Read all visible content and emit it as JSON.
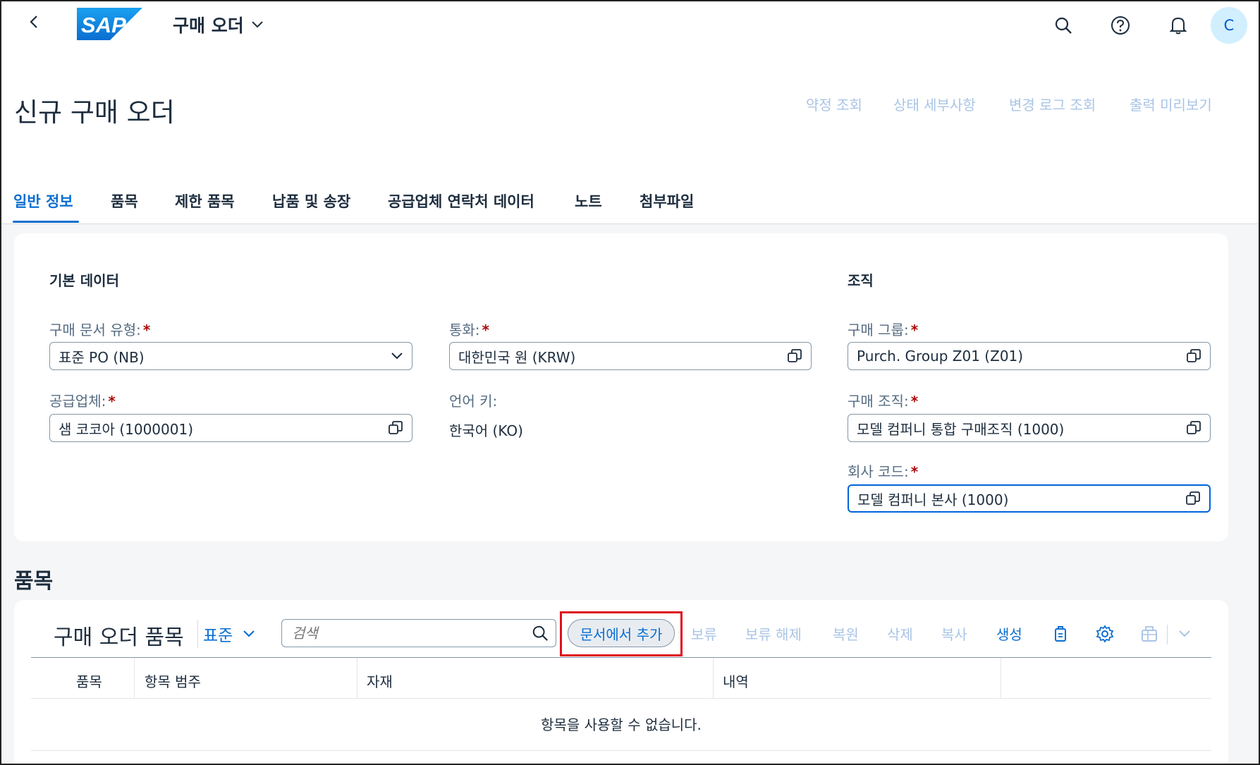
{
  "shell": {
    "logo_text": "SAP",
    "app_title": "구매 오더",
    "avatar_initial": "C"
  },
  "header": {
    "title": "신규 구매 오더",
    "actions": [
      "약정 조회",
      "상태 세부사항",
      "변경 로그 조회",
      "출력 미리보기"
    ]
  },
  "tabs": [
    "일반 정보",
    "품목",
    "제한 품목",
    "납품 및 송장",
    "공급업체 연락처 데이터",
    "노트",
    "첨부파일"
  ],
  "basic_data": {
    "title": "기본 데이터",
    "doc_type_label": "구매 문서 유형:",
    "doc_type_value": "표준 PO (NB)",
    "supplier_label": "공급업체:",
    "supplier_value": "샘 코코아 (1000001)",
    "currency_label": "통화:",
    "currency_value": "대한민국 원 (KRW)",
    "language_label": "언어 키:",
    "language_value": "한국어 (KO)"
  },
  "organization": {
    "title": "조직",
    "purch_group_label": "구매 그룹:",
    "purch_group_value": "Purch. Group Z01 (Z01)",
    "purch_org_label": "구매 조직:",
    "purch_org_value": "모델 컴퍼니 통합 구매조직 (1000)",
    "company_code_label": "회사 코드:",
    "company_code_value": "모델 컴퍼니 본사 (1000)"
  },
  "required_marker": "*",
  "items": {
    "section_title": "품목",
    "table_title": "구매 오더 품목",
    "variant": "표준",
    "search_placeholder": "검색",
    "add_from_document": "문서에서 추가",
    "toolbar": {
      "hold": "보류",
      "release_hold": "보류 해제",
      "restore": "복원",
      "delete": "삭제",
      "copy": "복사",
      "create": "생성"
    },
    "columns": [
      "품목",
      "항목 범주",
      "자재",
      "내역"
    ],
    "no_data": "항목을 사용할 수 없습니다."
  },
  "colors": {
    "brand_blue": "#0a6ed1",
    "highlight_red": "#e0101a",
    "required_red": "#aa0808",
    "disabled_link": "#a9c4e6"
  }
}
